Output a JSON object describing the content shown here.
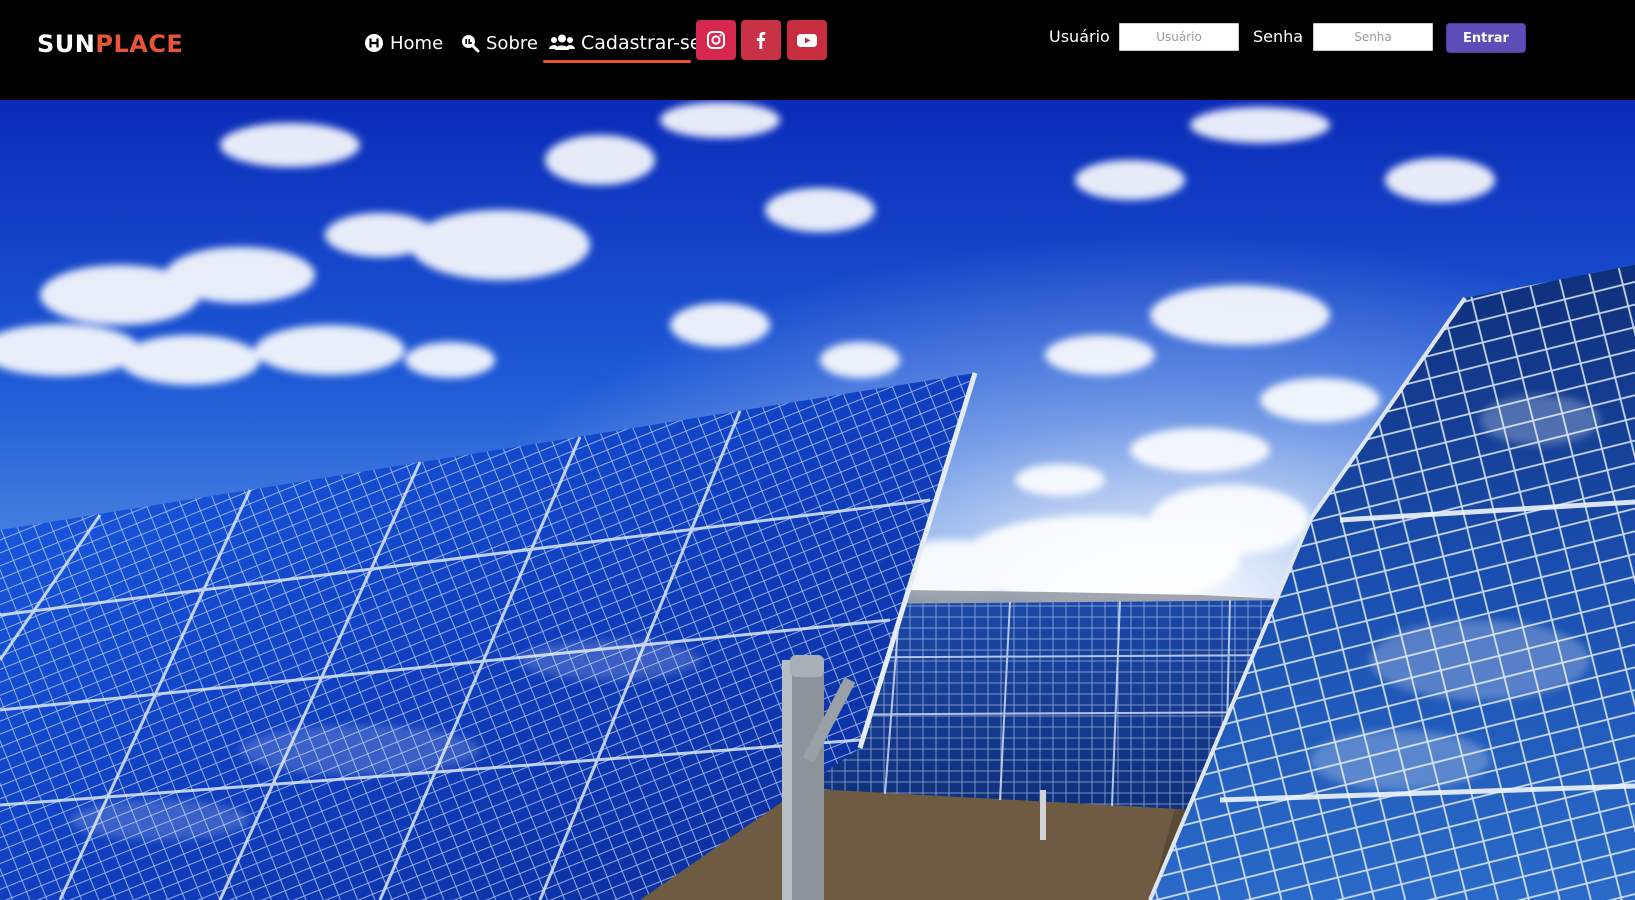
{
  "brand": {
    "part1": "SUN",
    "part2": "PLACE"
  },
  "nav": {
    "items": [
      {
        "label": "Home",
        "icon": "home-h-icon"
      },
      {
        "label": "Sobre",
        "icon": "search-info-icon"
      },
      {
        "label": "Cadastrar-se",
        "icon": "users-icon",
        "active": true
      }
    ],
    "active_color": "#e8553a"
  },
  "social": [
    {
      "name": "instagram",
      "icon": "instagram-icon",
      "color": "#d6274f"
    },
    {
      "name": "facebook",
      "icon": "facebook-icon",
      "color": "#c93246"
    },
    {
      "name": "youtube",
      "icon": "youtube-icon",
      "color": "#c72c3f"
    }
  ],
  "login": {
    "user_label": "Usuário",
    "user_placeholder": "Usuário",
    "pass_label": "Senha",
    "pass_placeholder": "Senha",
    "submit_label": "Entrar",
    "submit_color": "#5c4db8"
  },
  "hero": {
    "image_subject": "solar panels under blue sky with clouds"
  }
}
